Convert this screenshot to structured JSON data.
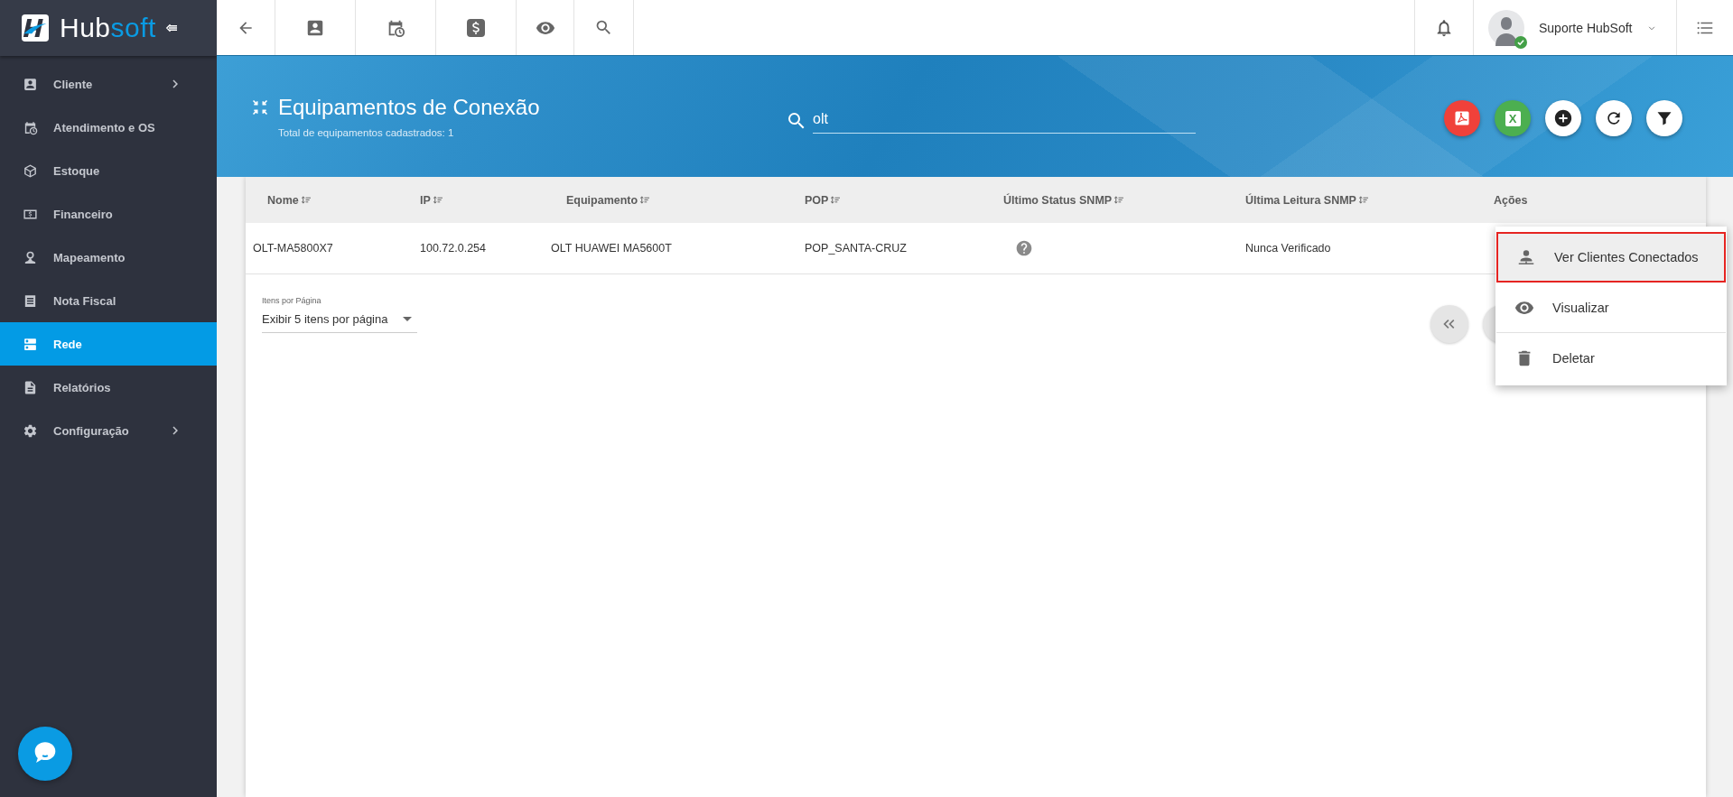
{
  "logo": {
    "primary": "Hub",
    "accent": "soft"
  },
  "sidebar": {
    "items": [
      {
        "kind": "client",
        "label": "Cliente",
        "has_submenu": true,
        "selected": false
      },
      {
        "kind": "service",
        "label": "Atendimento e OS",
        "has_submenu": false,
        "selected": false
      },
      {
        "kind": "stock",
        "label": "Estoque",
        "has_submenu": false,
        "selected": false
      },
      {
        "kind": "finance",
        "label": "Financeiro",
        "has_submenu": false,
        "selected": false
      },
      {
        "kind": "map",
        "label": "Mapeamento",
        "has_submenu": false,
        "selected": false
      },
      {
        "kind": "invoice",
        "label": "Nota Fiscal",
        "has_submenu": false,
        "selected": false
      },
      {
        "kind": "network",
        "label": "Rede",
        "has_submenu": false,
        "selected": true
      },
      {
        "kind": "report",
        "label": "Relatórios",
        "has_submenu": false,
        "selected": false
      },
      {
        "kind": "settings",
        "label": "Configuração",
        "has_submenu": true,
        "selected": false
      }
    ]
  },
  "user": {
    "name": "Suporte HubSoft",
    "online": true
  },
  "page": {
    "title": "Equipamentos de Conexão",
    "subtitle": "Total de equipamentos cadastrados: 1",
    "search": {
      "value": "olt"
    },
    "actions": [
      {
        "kind": "pdf"
      },
      {
        "kind": "excel",
        "glyph": "X"
      },
      {
        "kind": "add"
      },
      {
        "kind": "refresh"
      },
      {
        "kind": "filter"
      }
    ]
  },
  "table": {
    "columns": [
      {
        "label": "Nome",
        "sortable": true
      },
      {
        "label": "IP",
        "sortable": true
      },
      {
        "label": "Equipamento",
        "sortable": true
      },
      {
        "label": "POP",
        "sortable": true
      },
      {
        "label": "Último Status SNMP",
        "sortable": true
      },
      {
        "label": "Última Leitura SNMP",
        "sortable": true
      },
      {
        "label": "Ações",
        "sortable": false
      }
    ],
    "rows": [
      {
        "nome": "OLT-MA5800X7",
        "ip": "100.72.0.254",
        "equipamento": "OLT HUAWEI MA5600T",
        "pop": "POP_SANTA-CRUZ",
        "kind": "unknown",
        "ultima_leitura": "Nunca Verificado"
      }
    ]
  },
  "pagination": {
    "label": "Itens por Página",
    "value": "Exibir 5 itens por página"
  },
  "action_menu": {
    "items": [
      {
        "kind": "clients",
        "label": "Ver Clientes Conectados",
        "selected": true
      },
      {
        "kind": "view",
        "label": "Visualizar",
        "selected": false
      },
      {
        "kind": "delete",
        "label": "Deletar",
        "selected": false
      }
    ]
  }
}
